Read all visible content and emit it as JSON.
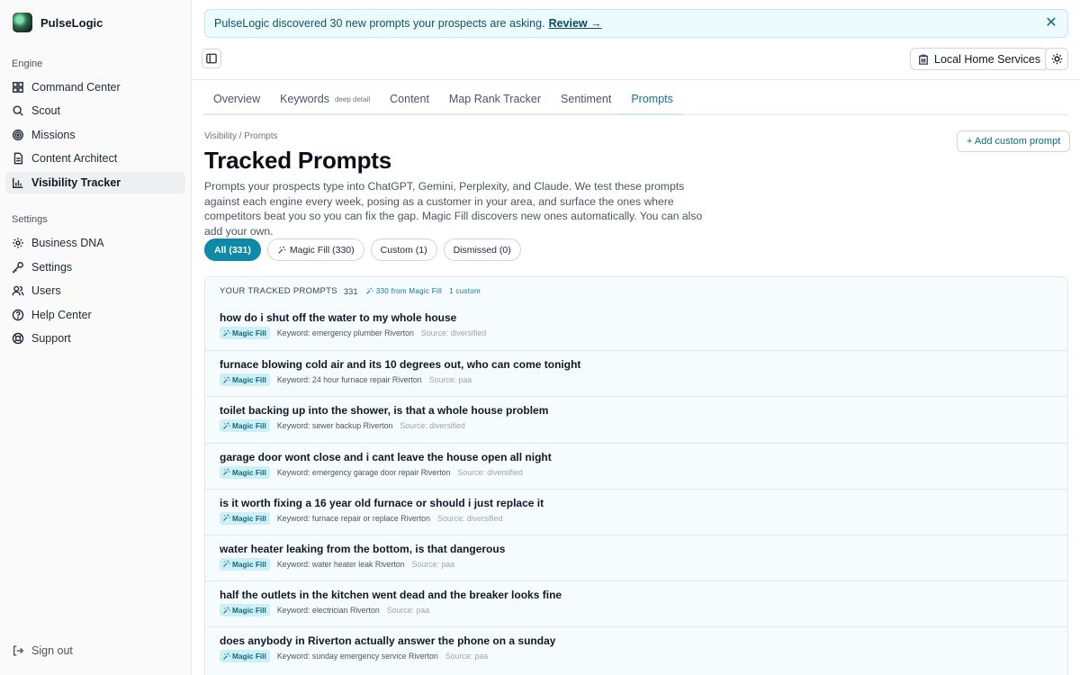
{
  "brand": {
    "name": "PulseLogic"
  },
  "sidebar": {
    "engine_label": "Engine",
    "engine_items": [
      {
        "label": "Command Center",
        "icon": "grid-icon"
      },
      {
        "label": "Scout",
        "icon": "search-icon"
      },
      {
        "label": "Missions",
        "icon": "target-icon"
      },
      {
        "label": "Content Architect",
        "icon": "document-icon"
      },
      {
        "label": "Visibility Tracker",
        "icon": "bar-chart-icon",
        "active": true
      }
    ],
    "settings_label": "Settings",
    "settings_items": [
      {
        "label": "Business DNA",
        "icon": "gear-icon"
      },
      {
        "label": "Settings",
        "icon": "key-icon"
      },
      {
        "label": "Users",
        "icon": "users-icon"
      },
      {
        "label": "Help Center",
        "icon": "help-icon"
      },
      {
        "label": "Support",
        "icon": "lifebuoy-icon"
      }
    ],
    "signout": "Sign out"
  },
  "banner": {
    "text": "PulseLogic discovered 30 new prompts your prospects are asking.",
    "link": "Review →"
  },
  "header": {
    "location": "Local Home Services"
  },
  "tabs": [
    {
      "label": "Overview"
    },
    {
      "label": "Keywords",
      "sub": "deep detail"
    },
    {
      "label": "Content"
    },
    {
      "label": "Map Rank Tracker"
    },
    {
      "label": "Sentiment"
    },
    {
      "label": "Prompts",
      "active": true
    }
  ],
  "page": {
    "breadcrumb": "Visibility / Prompts",
    "title": "Tracked Prompts",
    "description": "Prompts your prospects type into ChatGPT, Gemini, Perplexity, and Claude. We test these prompts against each engine every week, posing as a customer in your area, and surface the ones where competitors beat you so you can fix the gap. Magic Fill discovers new ones automatically. You can also add your own.",
    "add_button": "+ Add custom prompt"
  },
  "filters": [
    {
      "label": "All (331)",
      "active": true
    },
    {
      "label": "Magic Fill (330)",
      "icon": true
    },
    {
      "label": "Custom (1)"
    },
    {
      "label": "Dismissed (0)"
    }
  ],
  "panel": {
    "heading": "YOUR TRACKED PROMPTS",
    "count": "331",
    "magic_fill": "330 from Magic Fill",
    "custom": "1 custom",
    "rows": [
      {
        "q": "how do i shut off the water to my whole house",
        "badge": "Magic Fill",
        "keyword": "Keyword: emergency plumber Riverton",
        "source": "Source: diversified"
      },
      {
        "q": "furnace blowing cold air and its 10 degrees out, who can come tonight",
        "badge": "Magic Fill",
        "keyword": "Keyword: 24 hour furnace repair Riverton",
        "source": "Source: paa"
      },
      {
        "q": "toilet backing up into the shower, is that a whole house problem",
        "badge": "Magic Fill",
        "keyword": "Keyword: sewer backup Riverton",
        "source": "Source: diversified"
      },
      {
        "q": "garage door wont close and i cant leave the house open all night",
        "badge": "Magic Fill",
        "keyword": "Keyword: emergency garage door repair Riverton",
        "source": "Source: diversified"
      },
      {
        "q": "is it worth fixing a 16 year old furnace or should i just replace it",
        "badge": "Magic Fill",
        "keyword": "Keyword: furnace repair or replace Riverton",
        "source": "Source: diversified"
      },
      {
        "q": "water heater leaking from the bottom, is that dangerous",
        "badge": "Magic Fill",
        "keyword": "Keyword: water heater leak Riverton",
        "source": "Source: paa"
      },
      {
        "q": "half the outlets in the kitchen went dead and the breaker looks fine",
        "badge": "Magic Fill",
        "keyword": "Keyword: electrician Riverton",
        "source": "Source: paa"
      },
      {
        "q": "does anybody in Riverton actually answer the phone on a sunday",
        "badge": "Magic Fill",
        "keyword": "Keyword: sunday emergency service Riverton",
        "source": "Source: paa"
      }
    ]
  }
}
